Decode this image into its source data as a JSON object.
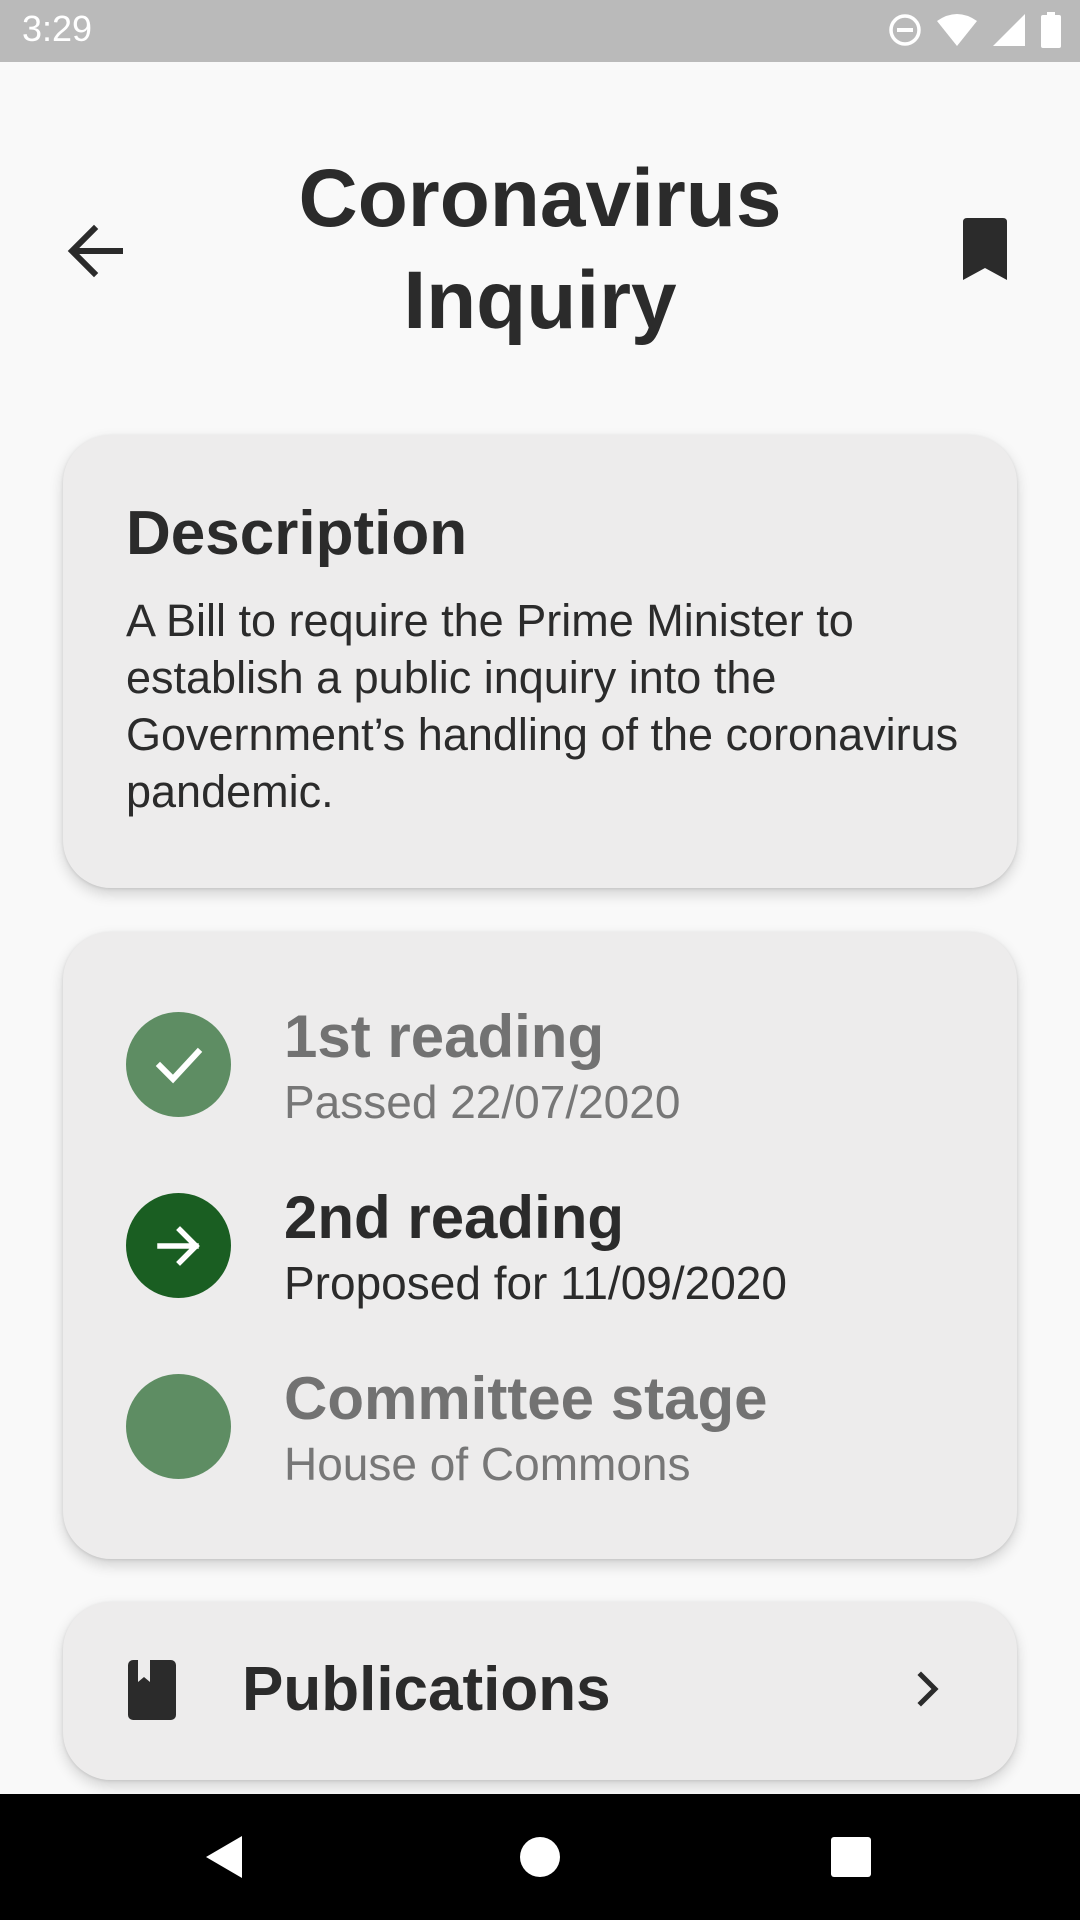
{
  "status_bar": {
    "time": "3:29",
    "icons": [
      "do-not-disturb-icon",
      "wifi-icon",
      "cellular-signal-icon",
      "battery-icon"
    ]
  },
  "header": {
    "title": "Coronavirus Inquiry",
    "back_icon": "arrow-back-icon",
    "bookmark_icon": "bookmark-icon"
  },
  "description": {
    "heading": "Description",
    "body": "A Bill to require the Prime Minister to establish a public inquiry into the Government’s handling of the coronavirus pandemic."
  },
  "stages": [
    {
      "title": "1st reading",
      "subtitle": "Passed 22/07/2020",
      "status": "completed",
      "icon": "check-icon"
    },
    {
      "title": "2nd reading",
      "subtitle": "Proposed for 11/09/2020",
      "status": "current",
      "icon": "arrow-forward-icon"
    },
    {
      "title": "Committee stage",
      "subtitle": "House of Commons",
      "status": "upcoming",
      "icon": ""
    }
  ],
  "publications": {
    "label": "Publications",
    "icon": "book-icon",
    "chevron_icon": "chevron-right-icon"
  },
  "nav_bar": {
    "buttons": [
      "back-triangle-icon",
      "home-circle-icon",
      "recents-square-icon"
    ]
  },
  "colors": {
    "stage_completed": "#5e8d63",
    "stage_current": "#1a5e22",
    "stage_upcoming": "#5e8d63",
    "card_background": "#edecec",
    "page_background": "#f9f9f9",
    "status_bar": "#bababa"
  }
}
